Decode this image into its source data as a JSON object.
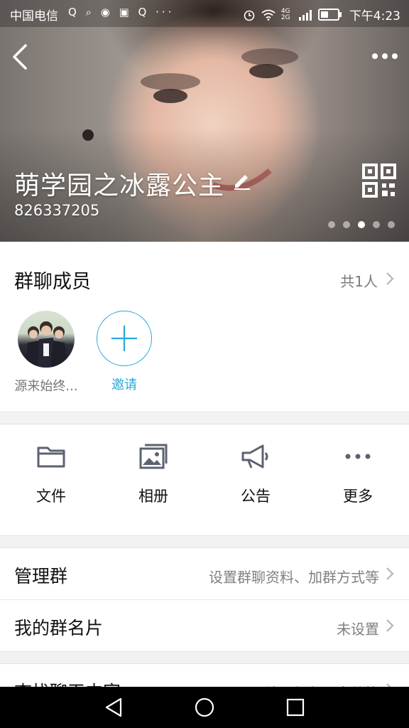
{
  "status_bar": {
    "carrier": "中国电信",
    "left_icons": "Q ⌕ ◉ ▣ Q ···",
    "time": "下午4:23",
    "network": "4G 2G"
  },
  "header": {
    "group_name": "萌学园之冰露公主",
    "group_id": "826337205",
    "carousel_pages": 5,
    "carousel_active": 3
  },
  "members": {
    "title": "群聊成员",
    "count": "共1人",
    "items": [
      {
        "name": "源来始终...",
        "avatar": "group-photo"
      }
    ],
    "invite_label": "邀请"
  },
  "features": [
    {
      "label": "文件",
      "icon": "folder-icon"
    },
    {
      "label": "相册",
      "icon": "album-icon"
    },
    {
      "label": "公告",
      "icon": "megaphone-icon"
    },
    {
      "label": "更多",
      "icon": "more-dots-icon"
    }
  ],
  "rows": [
    {
      "label": "管理群",
      "value": "设置群聊资料、加群方式等"
    },
    {
      "label": "我的群名片",
      "value": "未设置"
    },
    {
      "label": "查找聊天内容",
      "value": "图片、视频、文件等"
    }
  ],
  "colors": {
    "accent": "#2aa7d8",
    "icon_gray": "#5b6270",
    "separator": "#f2f2f4"
  }
}
